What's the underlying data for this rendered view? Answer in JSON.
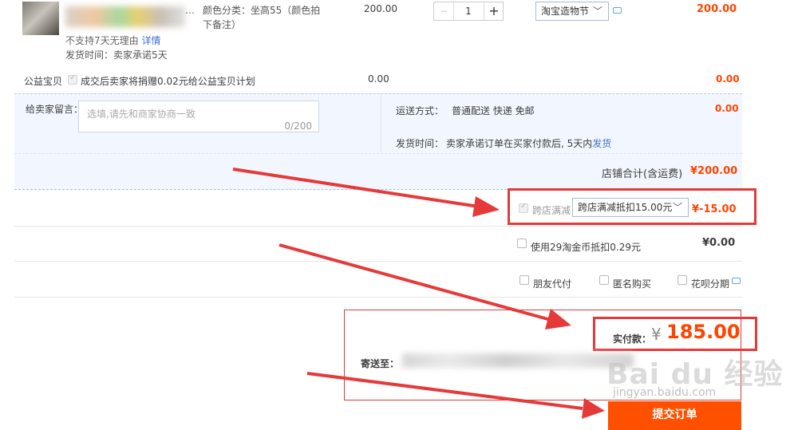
{
  "item": {
    "title_visible": "…",
    "color_label": "颜色分类：坐高55（颜色拍下备注）",
    "unit_price": "200.00",
    "quantity": "1",
    "qty_minus": "−",
    "qty_plus": "+",
    "promo_selected": "淘宝造物节",
    "no_return_text": "不支持7天无理由",
    "details_link": "详情",
    "ship_time": "发货时间：卖家承诺5天",
    "subtotal": "200.00"
  },
  "charity": {
    "label": "公益宝贝",
    "text": "成交后卖家将捐赠0.02元给公益宝贝计划",
    "amount": "0.00",
    "amount_right": "0.00"
  },
  "message": {
    "label": "给卖家留言：",
    "placeholder": "选填,请先和商家协商一致",
    "counter": "0/200"
  },
  "shipping": {
    "method_label": "运送方式：",
    "method_value": "普通配送 快递 免邮",
    "method_price": "0.00",
    "time_label": "发货时间：",
    "time_value": "卖家承诺订单在买家付款后, 5天内",
    "time_link": "发货"
  },
  "store_total": {
    "label": "店铺合计(含运费)",
    "value": "¥200.00"
  },
  "cross_store": {
    "label": "跨店满减",
    "option": "跨店满减抵扣15.00元",
    "value": "¥-15.00"
  },
  "coins": {
    "label": "使用29淘金币抵扣0.29元",
    "value": "¥0.00"
  },
  "options": {
    "friend_pay": "朋友代付",
    "anonymous": "匿名购买",
    "huabei": "花呗分期"
  },
  "summary": {
    "paid_label": "实付款：",
    "currency": "¥",
    "paid_value": "185.00",
    "ship_to_label": "寄送至：",
    "submit": "提交订单"
  },
  "watermark": {
    "brand": "Bai du 经验",
    "url": "jingyan.baidu.com"
  },
  "colors": {
    "accent": "#ff4400",
    "submit_bg": "#ff5000",
    "annotation_red": "#e53a3a",
    "row_blue": "#f2f7ff",
    "link_blue": "#3c6fcf"
  },
  "icons": [
    "chat-icon",
    "chevron-down-icon",
    "checkbox-icon",
    "arrow-annotation"
  ]
}
